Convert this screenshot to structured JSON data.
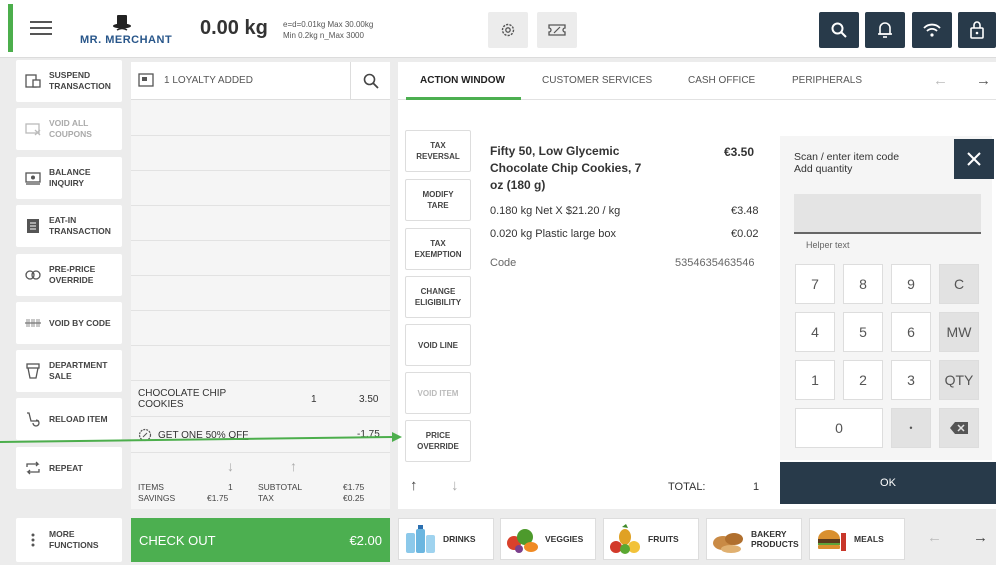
{
  "header": {
    "brand": "MR. MERCHANT",
    "weight": "0.00 kg",
    "scale_line1": "e=d=0.01kg Max 30.00kg",
    "scale_line2": "Min 0.2kg n_Max 3000",
    "icons": [
      "menu-icon",
      "settings-icon",
      "coupon-icon",
      "search-icon",
      "bell-icon",
      "wifi-icon",
      "lock-icon"
    ]
  },
  "left_menu": [
    {
      "label1": "SUSPEND",
      "label2": "TRANSACTION",
      "icon": "suspend-icon",
      "enabled": true
    },
    {
      "label1": "VOID ALL",
      "label2": "COUPONS",
      "icon": "void-coupons-icon",
      "enabled": false
    },
    {
      "label1": "BALANCE",
      "label2": "INQUIRY",
      "icon": "balance-icon",
      "enabled": true
    },
    {
      "label1": "EAT-IN",
      "label2": "TRANSACTION",
      "icon": "eat-in-icon",
      "enabled": true
    },
    {
      "label1": "PRE-PRICE",
      "label2": "OVERRIDE",
      "icon": "pre-price-icon",
      "enabled": true
    },
    {
      "label1": "VOID BY CODE",
      "label2": "",
      "icon": "barcode-icon",
      "enabled": true
    },
    {
      "label1": "DEPARTMENT",
      "label2": "SALE",
      "icon": "department-icon",
      "enabled": true
    },
    {
      "label1": "RELOAD ITEM",
      "label2": "",
      "icon": "reload-icon",
      "enabled": true
    },
    {
      "label1": "REPEAT",
      "label2": "",
      "icon": "repeat-icon",
      "enabled": true
    },
    {
      "label1": "MORE",
      "label2": "FUNCTIONS",
      "icon": "more-icon",
      "enabled": true
    }
  ],
  "order": {
    "loyalty": "1 LOYALTY ADDED",
    "item": {
      "name": "CHOCOLATE CHIP COOKIES",
      "qty": "1",
      "price": "3.50"
    },
    "promo": {
      "label": "GET ONE 50% OFF",
      "value": "-1.75"
    },
    "totals": {
      "items_label": "ITEMS",
      "items_value": "1",
      "savings_label": "SAVINGS",
      "savings_value": "€1.75",
      "subtotal_label": "SUBTOTAL",
      "subtotal_value": "€1.75",
      "tax_label": "TAX",
      "tax_value": "€0.25"
    },
    "checkout_label": "CHECK OUT",
    "checkout_value": "€2.00"
  },
  "action_window": {
    "tabs": [
      "ACTION WINDOW",
      "CUSTOMER SERVICES",
      "CASH OFFICE",
      "PERIPHERALS"
    ],
    "functions": [
      {
        "l1": "TAX",
        "l2": "REVERSAL",
        "enabled": true
      },
      {
        "l1": "MODIFY",
        "l2": "TARE",
        "enabled": true
      },
      {
        "l1": "TAX",
        "l2": "EXEMPTION",
        "enabled": true
      },
      {
        "l1": "CHANGE",
        "l2": "ELIGIBILITY",
        "enabled": true
      },
      {
        "l1": "VOID LINE",
        "l2": "",
        "enabled": true
      },
      {
        "l1": "VOID ITEM",
        "l2": "",
        "enabled": false
      },
      {
        "l1": "PRICE",
        "l2": "OVERRIDE",
        "enabled": true
      }
    ],
    "product": {
      "name": "Fifty 50, Low Glycemic Chocolate Chip Cookies, 7 oz (180 g)",
      "price": "€3.50",
      "line1": "0.180 kg Net X $21.20 / kg",
      "line1_value": "€3.48",
      "line2": "0.020 kg Plastic large box",
      "line2_value": "€0.02",
      "code_label": "Code",
      "code_value": "5354635463546"
    },
    "total_label": "TOTAL:",
    "total_value": "1"
  },
  "keypad": {
    "title1": "Scan / enter item code",
    "title2": "Add quantity",
    "input_value": "",
    "helper": "Helper text",
    "keys": [
      [
        "7",
        "8",
        "9",
        "C"
      ],
      [
        "4",
        "5",
        "6",
        "MW"
      ],
      [
        "1",
        "2",
        "3",
        "QTY"
      ],
      [
        "0",
        "•",
        "backspace-icon"
      ]
    ],
    "ok": "OK"
  },
  "categories": [
    {
      "label1": "DRINKS",
      "label2": ""
    },
    {
      "label1": "VEGGIES",
      "label2": ""
    },
    {
      "label1": "FRUITS",
      "label2": ""
    },
    {
      "label1": "BAKERY",
      "label2": "PRODUCTS"
    },
    {
      "label1": "MEALS",
      "label2": ""
    }
  ],
  "colors": {
    "accent": "#4caf50",
    "dark": "#283a4a",
    "annotation": "#4cae4c"
  }
}
